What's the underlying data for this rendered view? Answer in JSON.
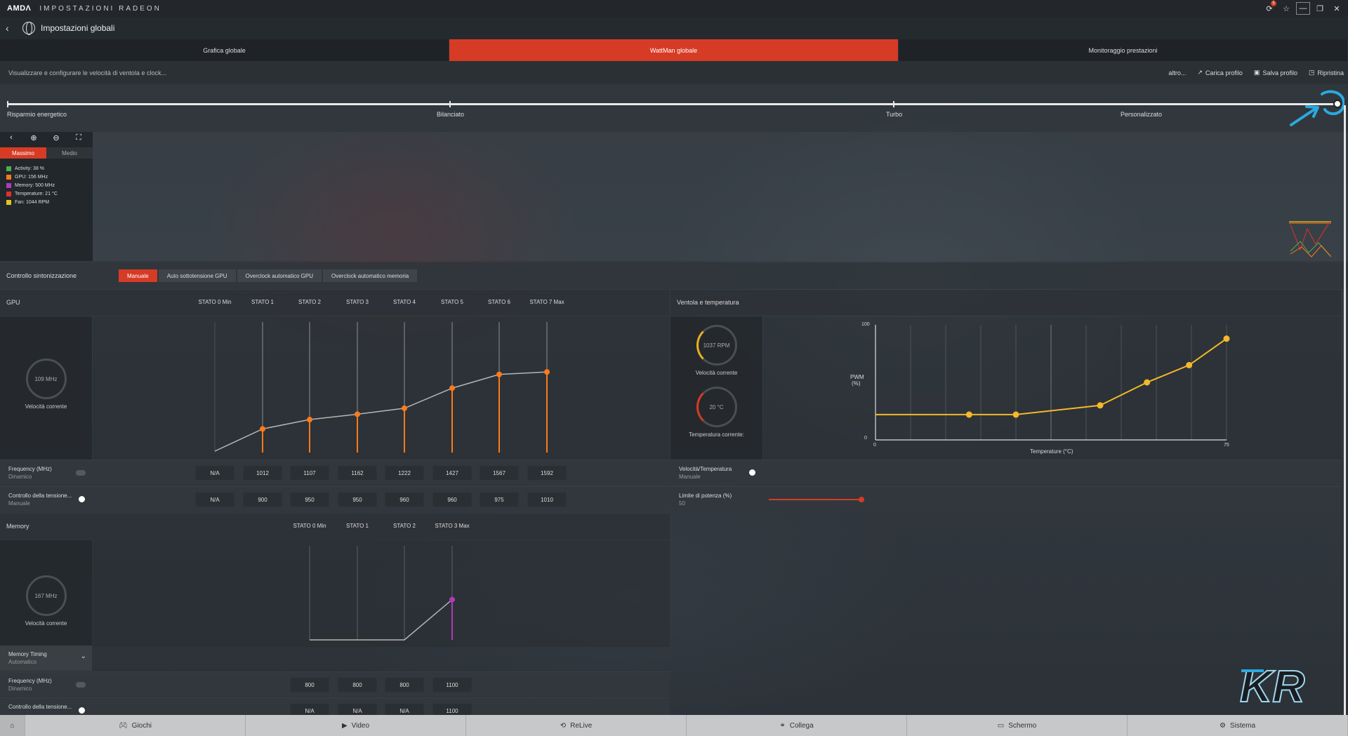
{
  "titlebar": {
    "logo": "AMDΛ",
    "title": "IMPOSTAZIONI RADEON",
    "notif_count": "5"
  },
  "header": {
    "title": "Impostazioni globali"
  },
  "tabs": [
    {
      "label": "Grafica globale",
      "active": false
    },
    {
      "label": "WattMan globale",
      "active": true
    },
    {
      "label": "Monitoraggio prestazioni",
      "active": false
    }
  ],
  "subheader": {
    "description": "Visualizzare e configurare le velocità di ventola e clock...",
    "more": "altro...",
    "load_profile": "Carica profilo",
    "save_profile": "Salva profilo",
    "reset": "Ripristina"
  },
  "presets": [
    "Risparmio energetico",
    "Bilanciato",
    "Turbo",
    "Personalizzato"
  ],
  "monitor": {
    "tabs": [
      "Massimo",
      "Medio"
    ],
    "legend": [
      {
        "text": "Activity: 38 %",
        "color": "#4caf50"
      },
      {
        "text": "GPU: 156 MHz",
        "color": "#ff7a1a"
      },
      {
        "text": "Memory: 500 MHz",
        "color": "#b03ab8"
      },
      {
        "text": "Temperature: 21 °C",
        "color": "#e03030"
      },
      {
        "text": "Fan: 1044 RPM",
        "color": "#e8c020"
      }
    ]
  },
  "tuning": {
    "label": "Controllo sintonizzazione",
    "modes": [
      "Manuale",
      "Auto sottotensione GPU",
      "Overclock automatico GPU",
      "Overclock automatico memoria"
    ]
  },
  "gpu": {
    "title": "GPU",
    "gauge_value": "109 MHz",
    "gauge_caption": "Velocità corrente",
    "states": [
      "STATO 0 Min",
      "STATO 1",
      "STATO 2",
      "STATO 3",
      "STATO 4",
      "STATO 5",
      "STATO 6",
      "STATO 7 Max"
    ],
    "frequency_label": "Frequency (MHz)",
    "frequency_mode": "Dinamico",
    "frequency": [
      "N/A",
      "1012",
      "1107",
      "1162",
      "1222",
      "1427",
      "1567",
      "1592"
    ],
    "voltage_label": "Controllo della tensione...",
    "voltage_mode": "Manuale",
    "voltage": [
      "N/A",
      "900",
      "950",
      "950",
      "960",
      "960",
      "975",
      "1010"
    ]
  },
  "fan": {
    "title": "Ventola e temperatura",
    "speed_value": "1037 RPM",
    "speed_caption": "Velocità corrente",
    "temp_value": "20 °C",
    "temp_caption": "Temperatura corrente:",
    "y_label_1": "PWM",
    "y_label_2": "(%)",
    "x_label": "Temperature (°C)",
    "y_max": "100",
    "y_min": "0",
    "x_min": "0",
    "x_max": "75",
    "speed_temp_label": "Velocità/Temperatura",
    "speed_temp_mode": "Manuale",
    "power_label": "Limite di potenza (%)",
    "power_value": "50"
  },
  "memory": {
    "title": "Memory",
    "gauge_value": "167 MHz",
    "gauge_caption": "Velocità corrente",
    "states": [
      "STATO 0 Min",
      "STATO 1",
      "STATO 2",
      "STATO 3 Max"
    ],
    "timing_label": "Memory Timing",
    "timing_mode": "Automatico",
    "frequency_label": "Frequency (MHz)",
    "frequency_mode": "Dinamico",
    "frequency": [
      "800",
      "800",
      "800",
      "1100"
    ],
    "voltage_label": "Controllo della tensione...",
    "voltage": [
      "N/A",
      "N/A",
      "N/A",
      "1100"
    ]
  },
  "bottom_nav": [
    "Giochi",
    "Video",
    "ReLive",
    "Collega",
    "Schermo",
    "Sistema"
  ],
  "chart_data": [
    {
      "type": "line",
      "x": [
        "STATO 0 Min",
        "STATO 1",
        "STATO 2",
        "STATO 3",
        "STATO 4",
        "STATO 5",
        "STATO 6",
        "STATO 7 Max"
      ],
      "series": [
        {
          "values": [
            null,
            1012,
            1107,
            1162,
            1222,
            1427,
            1567,
            1592
          ]
        }
      ]
    },
    {
      "type": "line",
      "x": [
        0,
        20,
        30,
        48,
        58,
        67,
        75
      ],
      "series": [
        {
          "values": [
            22,
            22,
            22,
            30,
            50,
            65,
            88
          ]
        }
      ],
      "xlabel": "Temperature (°C)",
      "ylabel": "PWM (%)",
      "xlim": [
        0,
        75
      ],
      "ylim": [
        0,
        100
      ]
    },
    {
      "type": "line",
      "x": [
        "STATO 0 Min",
        "STATO 1",
        "STATO 2",
        "STATO 3 Max"
      ],
      "series": [
        {
          "values": [
            800,
            800,
            800,
            1100
          ]
        }
      ]
    }
  ]
}
